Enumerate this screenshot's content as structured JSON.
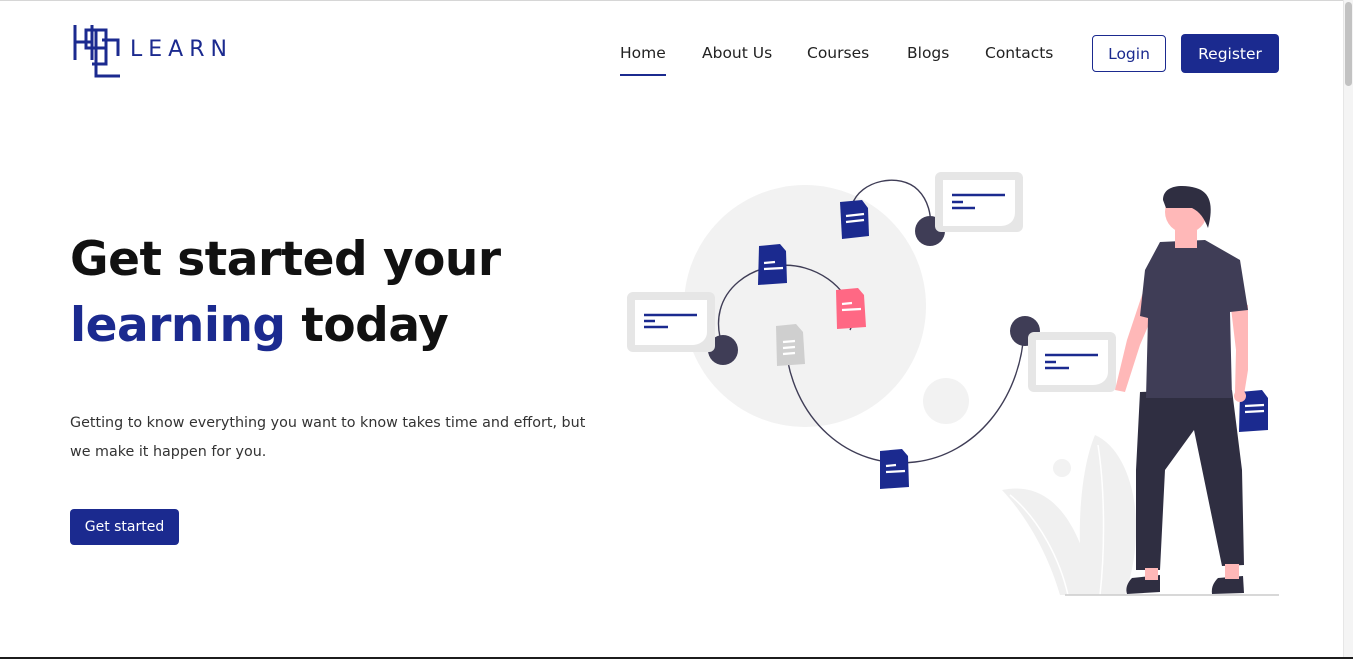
{
  "brand": {
    "logo_text": "LEARN",
    "accent_color": "#1b2a8f"
  },
  "nav": {
    "items": [
      {
        "label": "Home",
        "active": true
      },
      {
        "label": "About Us",
        "active": false
      },
      {
        "label": "Courses",
        "active": false
      },
      {
        "label": "Blogs",
        "active": false
      },
      {
        "label": "Contacts",
        "active": false
      }
    ],
    "login_label": "Login",
    "register_label": "Register"
  },
  "hero": {
    "title_line1": "Get started your",
    "title_line2_accent": "learning",
    "title_line2_rest": " today",
    "description": "Getting to know everything you want to know takes time and effort, but we make it happen for you.",
    "cta_label": "Get started"
  },
  "colors": {
    "primary": "#1b2a8f",
    "pink": "#ff6884",
    "dark": "#3f3d56",
    "light_gray": "#f2f2f2",
    "skin": "#ffb8b8"
  }
}
